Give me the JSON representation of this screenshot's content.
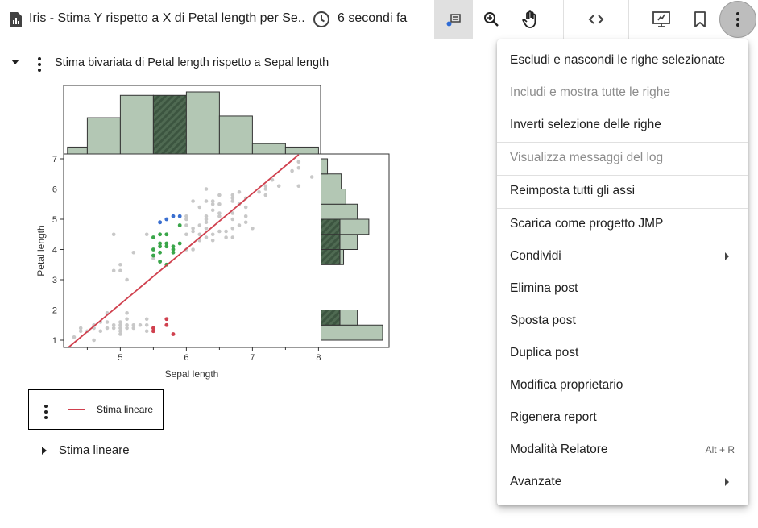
{
  "header": {
    "title": "Iris - Stima Y rispetto a X di Petal length per Se...",
    "time": "6 secondi fa",
    "icons": [
      "doc-chart-icon",
      "clock-icon",
      "select-rows-icon",
      "zoom-icon",
      "hand-icon",
      "code-icon",
      "presentation-icon",
      "bookmark-icon",
      "more-vert-icon"
    ]
  },
  "report": {
    "title": "Stima bivariata di Petal length rispetto a Sepal length",
    "legend_label": "Stima lineare",
    "sub_title": "Stima lineare"
  },
  "menu": {
    "items": [
      {
        "label": "Escludi e nascondi le righe selezionate",
        "disabled": false,
        "shortcut": "",
        "submenu": false
      },
      {
        "label": "Includi e mostra tutte le righe",
        "disabled": true,
        "shortcut": "",
        "submenu": false
      },
      {
        "label": "Inverti selezione delle righe",
        "disabled": false,
        "shortcut": "",
        "submenu": false
      },
      {
        "label": "Visualizza messaggi del log",
        "disabled": true,
        "shortcut": "",
        "submenu": false
      },
      {
        "label": "Reimposta tutti gli assi",
        "disabled": false,
        "shortcut": "",
        "submenu": false
      },
      {
        "label": "Scarica come progetto JMP",
        "disabled": false,
        "shortcut": "",
        "submenu": false
      },
      {
        "label": "Condividi",
        "disabled": false,
        "shortcut": "",
        "submenu": true
      },
      {
        "label": "Elimina post",
        "disabled": false,
        "shortcut": "",
        "submenu": false
      },
      {
        "label": "Sposta post",
        "disabled": false,
        "shortcut": "",
        "submenu": false
      },
      {
        "label": "Duplica post",
        "disabled": false,
        "shortcut": "",
        "submenu": false
      },
      {
        "label": "Modifica proprietario",
        "disabled": false,
        "shortcut": "",
        "submenu": false
      },
      {
        "label": "Rigenera report",
        "disabled": false,
        "shortcut": "",
        "submenu": false
      },
      {
        "label": "Modalità Relatore",
        "disabled": false,
        "shortcut": "Alt + R",
        "submenu": false
      },
      {
        "label": "Avanzate",
        "disabled": false,
        "shortcut": "",
        "submenu": true
      }
    ]
  },
  "chart_data": {
    "type": "scatter",
    "xlabel": "Sepal length",
    "ylabel": "Petal length",
    "xlim": [
      4.2,
      8.1
    ],
    "ylim": [
      0.8,
      7.1
    ],
    "x_ticks": [
      "5",
      "6",
      "7",
      "8"
    ],
    "y_ticks": [
      "1",
      "2",
      "3",
      "4",
      "5",
      "6",
      "7"
    ],
    "colors": {
      "unselected": "#c8c8c8",
      "red": "#d0404e",
      "green": "#3aa64a",
      "blue": "#3a6fd0",
      "fit_line": "#d0404e",
      "hist_fill": "#b3c7b4",
      "hist_selected": "#4f6a52"
    },
    "fit_line": {
      "name": "Stima lineare",
      "points": [
        [
          4.3,
          0.8
        ],
        [
          7.7,
          7.1
        ]
      ]
    },
    "points_unselected": [
      [
        4.3,
        1.1
      ],
      [
        4.4,
        1.3
      ],
      [
        4.4,
        1.4
      ],
      [
        4.5,
        1.3
      ],
      [
        4.6,
        1.0
      ],
      [
        4.6,
        1.4
      ],
      [
        4.6,
        1.5
      ],
      [
        4.7,
        1.3
      ],
      [
        4.7,
        1.6
      ],
      [
        4.8,
        1.4
      ],
      [
        4.8,
        1.6
      ],
      [
        4.8,
        1.9
      ],
      [
        4.9,
        1.4
      ],
      [
        4.9,
        1.5
      ],
      [
        4.9,
        3.3
      ],
      [
        4.9,
        4.5
      ],
      [
        5.0,
        1.2
      ],
      [
        5.0,
        1.3
      ],
      [
        5.0,
        1.4
      ],
      [
        5.0,
        1.5
      ],
      [
        5.0,
        1.6
      ],
      [
        5.0,
        3.3
      ],
      [
        5.0,
        3.5
      ],
      [
        5.1,
        1.4
      ],
      [
        5.1,
        1.5
      ],
      [
        5.1,
        1.7
      ],
      [
        5.1,
        1.9
      ],
      [
        5.1,
        3.0
      ],
      [
        5.2,
        1.4
      ],
      [
        5.2,
        1.5
      ],
      [
        5.2,
        3.9
      ],
      [
        5.3,
        1.5
      ],
      [
        5.4,
        1.3
      ],
      [
        5.4,
        1.5
      ],
      [
        5.4,
        1.7
      ],
      [
        5.4,
        4.5
      ],
      [
        5.5,
        1.3
      ],
      [
        5.5,
        3.7
      ],
      [
        5.5,
        3.8
      ],
      [
        5.6,
        3.6
      ],
      [
        5.7,
        1.5
      ],
      [
        5.8,
        1.2
      ],
      [
        5.9,
        4.2
      ],
      [
        5.9,
        4.8
      ],
      [
        5.9,
        5.1
      ],
      [
        6.0,
        4.0
      ],
      [
        6.0,
        4.5
      ],
      [
        6.0,
        4.8
      ],
      [
        6.0,
        5.0
      ],
      [
        6.0,
        5.1
      ],
      [
        6.1,
        4.0
      ],
      [
        6.1,
        4.6
      ],
      [
        6.1,
        4.7
      ],
      [
        6.1,
        5.6
      ],
      [
        6.2,
        4.3
      ],
      [
        6.2,
        4.5
      ],
      [
        6.2,
        4.8
      ],
      [
        6.2,
        5.4
      ],
      [
        6.3,
        4.4
      ],
      [
        6.3,
        4.7
      ],
      [
        6.3,
        4.9
      ],
      [
        6.3,
        5.0
      ],
      [
        6.3,
        5.1
      ],
      [
        6.3,
        5.6
      ],
      [
        6.3,
        6.0
      ],
      [
        6.4,
        4.3
      ],
      [
        6.4,
        4.5
      ],
      [
        6.4,
        5.3
      ],
      [
        6.4,
        5.5
      ],
      [
        6.4,
        5.6
      ],
      [
        6.5,
        4.6
      ],
      [
        6.5,
        5.1
      ],
      [
        6.5,
        5.2
      ],
      [
        6.5,
        5.5
      ],
      [
        6.5,
        5.8
      ],
      [
        6.6,
        4.4
      ],
      [
        6.6,
        4.6
      ],
      [
        6.7,
        4.4
      ],
      [
        6.7,
        4.7
      ],
      [
        6.7,
        5.0
      ],
      [
        6.7,
        5.2
      ],
      [
        6.7,
        5.6
      ],
      [
        6.7,
        5.7
      ],
      [
        6.7,
        5.8
      ],
      [
        6.8,
        4.8
      ],
      [
        6.8,
        5.5
      ],
      [
        6.8,
        5.9
      ],
      [
        6.9,
        4.9
      ],
      [
        6.9,
        5.1
      ],
      [
        6.9,
        5.4
      ],
      [
        6.9,
        5.7
      ],
      [
        7.0,
        4.7
      ],
      [
        7.1,
        5.9
      ],
      [
        7.2,
        5.8
      ],
      [
        7.2,
        6.0
      ],
      [
        7.2,
        6.1
      ],
      [
        7.3,
        6.3
      ],
      [
        7.4,
        6.1
      ],
      [
        7.6,
        6.6
      ],
      [
        7.7,
        6.1
      ],
      [
        7.7,
        6.7
      ],
      [
        7.7,
        6.9
      ],
      [
        7.9,
        6.4
      ]
    ],
    "points_red": [
      [
        5.5,
        1.3
      ],
      [
        5.5,
        1.4
      ],
      [
        5.7,
        1.5
      ],
      [
        5.7,
        1.7
      ],
      [
        5.8,
        1.2
      ]
    ],
    "points_green": [
      [
        5.5,
        3.8
      ],
      [
        5.5,
        4.0
      ],
      [
        5.5,
        4.4
      ],
      [
        5.6,
        3.6
      ],
      [
        5.6,
        3.9
      ],
      [
        5.6,
        4.1
      ],
      [
        5.6,
        4.2
      ],
      [
        5.6,
        4.5
      ],
      [
        5.7,
        3.5
      ],
      [
        5.7,
        4.1
      ],
      [
        5.7,
        4.2
      ],
      [
        5.7,
        4.5
      ],
      [
        5.8,
        3.9
      ],
      [
        5.8,
        4.0
      ],
      [
        5.8,
        4.1
      ],
      [
        5.9,
        4.2
      ],
      [
        5.9,
        4.8
      ]
    ],
    "points_blue": [
      [
        5.6,
        4.9
      ],
      [
        5.7,
        5.0
      ],
      [
        5.8,
        5.1
      ],
      [
        5.9,
        5.1
      ],
      [
        5.6,
        4.9
      ]
    ],
    "top_histogram": {
      "bin_edges": [
        4.2,
        4.5,
        5.0,
        5.5,
        6.0,
        6.5,
        7.0,
        7.5,
        8.0
      ],
      "counts": [
        4,
        21,
        34,
        34,
        36,
        22,
        6,
        4
      ],
      "selected_bin": 3
    },
    "right_histogram": {
      "bins": [
        [
          1.0,
          1.5
        ],
        [
          1.5,
          2.0
        ],
        [
          3.5,
          4.0
        ],
        [
          4.0,
          4.5
        ],
        [
          4.5,
          5.0
        ],
        [
          5.0,
          5.5
        ],
        [
          5.5,
          6.0
        ],
        [
          6.0,
          6.5
        ],
        [
          6.5,
          7.0
        ]
      ],
      "counts": [
        27,
        16,
        10,
        16,
        21,
        16,
        11,
        9,
        3
      ],
      "selected": [
        false,
        true,
        true,
        true,
        true,
        false,
        false,
        false,
        false
      ]
    }
  }
}
